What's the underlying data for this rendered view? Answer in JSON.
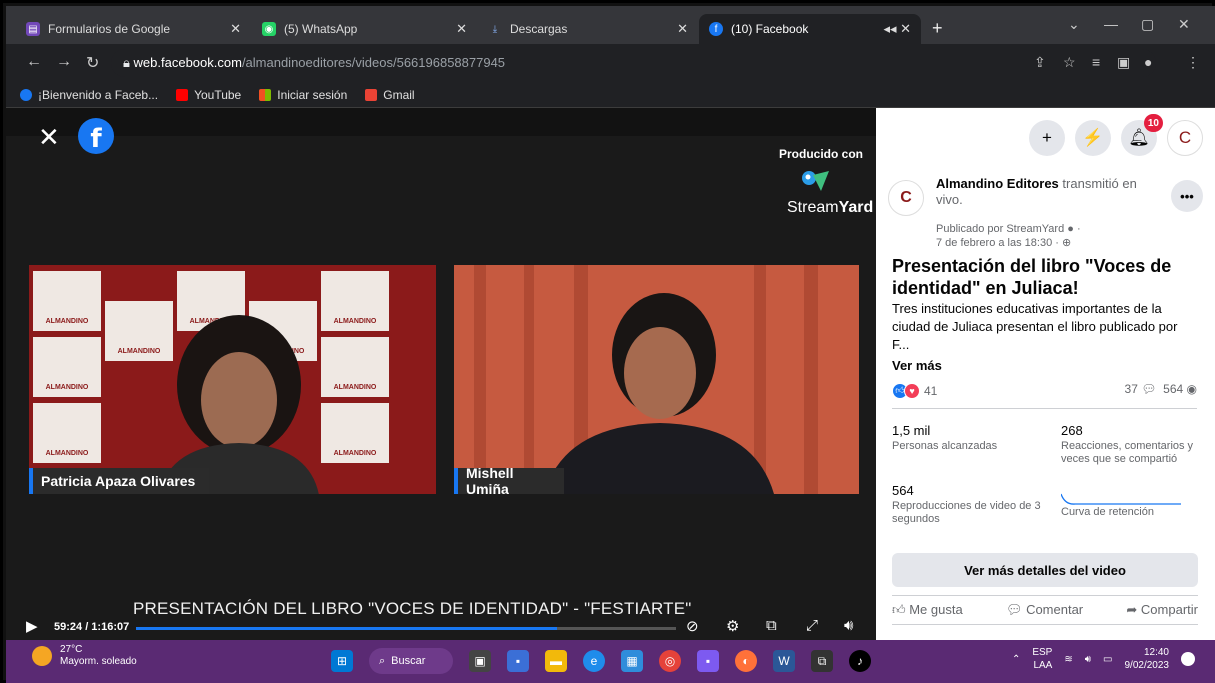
{
  "browser": {
    "tabs": [
      {
        "label": "Formularios de Google",
        "icon": "forms-icon",
        "color": "#7248b9"
      },
      {
        "label": "(5) WhatsApp",
        "icon": "whatsapp-icon",
        "color": "#25d366"
      },
      {
        "label": "Descargas",
        "icon": "download-icon",
        "color": "#8ab4f8"
      },
      {
        "label": "(10) Facebook",
        "icon": "facebook-icon",
        "color": "#1877f2"
      }
    ],
    "url_host": "web.facebook.com",
    "url_path": "/almandinoeditores/videos/566196858877945",
    "bookmarks": [
      {
        "label": "¡Bienvenido a Faceb...",
        "color": "#1877f2"
      },
      {
        "label": "YouTube",
        "color": "#ff0000"
      },
      {
        "label": "Iniciar sesión",
        "color": "#f25022"
      },
      {
        "label": "Gmail",
        "color": "#ea4335"
      }
    ]
  },
  "video": {
    "produced_with": "Producido con",
    "streamyard_a": "Stream",
    "streamyard_b": "Yard",
    "speaker1": "Patricia Apaza Olivares",
    "speaker2": "Mishell Umiña",
    "caption": "PRESENTACIÓN DEL LIBRO \"VOCES DE IDENTIDAD\" - \"FESTIARTE\"",
    "timecode": "59:24 / 1:16:07",
    "progress": 0.78,
    "wall_text": "ALMANDINO"
  },
  "panel": {
    "notifications_badge": "10",
    "page_name": "Almandino Editores",
    "action_text": "transmitió en vivo.",
    "published_by": "Publicado por StreamYard",
    "date": "7 de febrero a las 18:30",
    "title": "Presentación del libro \"Voces de identidad\" en Juliaca!",
    "description": "Tres instituciones educativas importantes de la ciudad de Juliaca presentan el libro publicado por F...",
    "see_more": "Ver más",
    "reactions_count": "41",
    "comments_count": "37",
    "views_count": "564",
    "stats": [
      {
        "num": "1,5 mil",
        "label": "Personas alcanzadas"
      },
      {
        "num": "268",
        "label": "Reacciones, comentarios y veces que se compartió"
      },
      {
        "num": "564",
        "label": "Reproducciones de video de 3 segundos"
      },
      {
        "label": "Curva de retención"
      }
    ],
    "details_button": "Ver más detalles del video",
    "like": "Me gusta",
    "comment": "Comentar",
    "share": "Compartir"
  },
  "taskbar": {
    "temp": "27°C",
    "weather": "Mayorm. soleado",
    "search": "Buscar",
    "lang1": "ESP",
    "lang2": "LAA",
    "time": "12:40",
    "date": "9/02/2023"
  }
}
